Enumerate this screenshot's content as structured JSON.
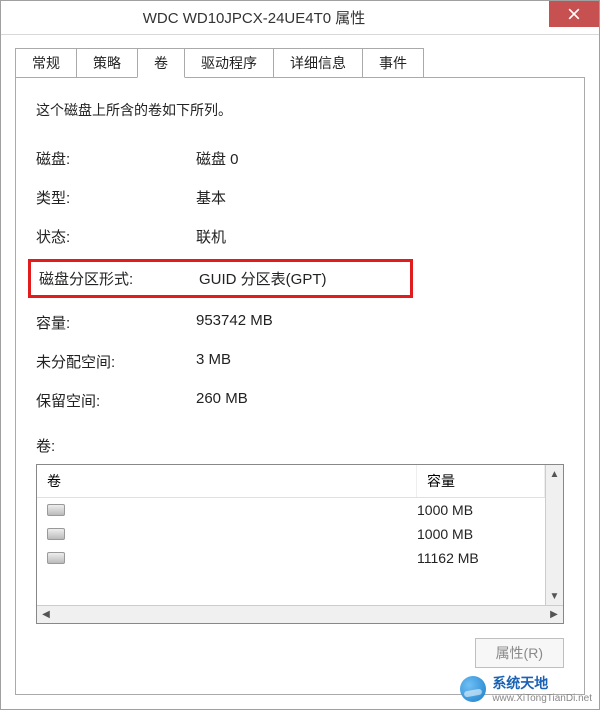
{
  "window": {
    "title": "WDC WD10JPCX-24UE4T0 属性"
  },
  "tabs": [
    {
      "label": "常规"
    },
    {
      "label": "策略"
    },
    {
      "label": "卷"
    },
    {
      "label": "驱动程序"
    },
    {
      "label": "详细信息"
    },
    {
      "label": "事件"
    }
  ],
  "active_tab_index": 2,
  "volumes_panel": {
    "intro": "这个磁盘上所含的卷如下所列。",
    "fields": {
      "disk_label": "磁盘:",
      "disk_value": "磁盘 0",
      "type_label": "类型:",
      "type_value": "基本",
      "status_label": "状态:",
      "status_value": "联机",
      "partition_style_label": "磁盘分区形式:",
      "partition_style_value": "GUID 分区表(GPT)",
      "capacity_label": "容量:",
      "capacity_value": "953742 MB",
      "unallocated_label": "未分配空间:",
      "unallocated_value": "3 MB",
      "reserved_label": "保留空间:",
      "reserved_value": "260 MB"
    },
    "list": {
      "section_label": "卷:",
      "headers": {
        "volume": "卷",
        "capacity": "容量"
      },
      "rows": [
        {
          "name": "",
          "capacity": "1000 MB"
        },
        {
          "name": "",
          "capacity": "1000 MB"
        },
        {
          "name": "",
          "capacity": "11162 MB"
        }
      ]
    },
    "buttons": {
      "properties": "属性(R)"
    }
  },
  "watermark": {
    "cn": "系统天地",
    "en": "www.XiTongTianDi.net"
  }
}
